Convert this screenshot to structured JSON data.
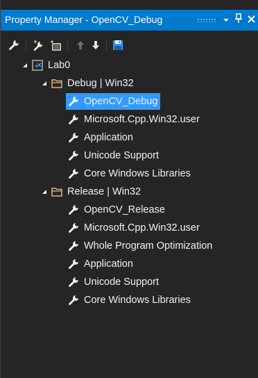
{
  "window": {
    "title": "Property Manager - OpenCV_Debug",
    "dropdown_icon": "chevron-down-icon",
    "pin_icon": "pin-icon",
    "close_icon": "close-icon"
  },
  "toolbar": {
    "items": [
      {
        "name": "properties-icon"
      },
      {
        "name": "add-new-property-sheet-icon"
      },
      {
        "name": "add-existing-property-sheet-icon"
      },
      {
        "name": "move-up-icon"
      },
      {
        "name": "move-down-icon"
      },
      {
        "name": "save-icon"
      }
    ]
  },
  "tree": {
    "project": {
      "label": "Lab0"
    },
    "configs": [
      {
        "label": "Debug | Win32",
        "sheets": [
          {
            "label": "OpenCV_Debug",
            "selected": true
          },
          {
            "label": "Microsoft.Cpp.Win32.user"
          },
          {
            "label": "Application"
          },
          {
            "label": "Unicode Support"
          },
          {
            "label": "Core Windows Libraries"
          }
        ]
      },
      {
        "label": "Release | Win32",
        "sheets": [
          {
            "label": "OpenCV_Release"
          },
          {
            "label": "Microsoft.Cpp.Win32.user"
          },
          {
            "label": "Whole Program Optimization"
          },
          {
            "label": "Application"
          },
          {
            "label": "Unicode Support"
          },
          {
            "label": "Core Windows Libraries"
          }
        ]
      }
    ]
  },
  "colors": {
    "titlebar": "#007acc",
    "selection": "#3399ff",
    "background": "#252526",
    "text": "#f1f1f1",
    "folder": "#dcb67a"
  }
}
